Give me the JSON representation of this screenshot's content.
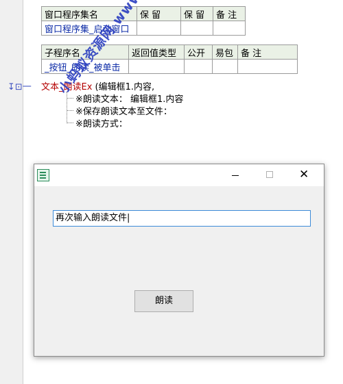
{
  "table1": {
    "headers": [
      "窗口程序集名",
      "保 留",
      "保 留",
      "备 注"
    ],
    "row": [
      "窗口程序集_启动窗口",
      "",
      "",
      ""
    ]
  },
  "table2": {
    "headers": [
      "子程序名",
      "返回值类型",
      "公开",
      "易包",
      "备 注"
    ],
    "row": [
      "_按钮_朗读_被单击",
      "",
      "",
      "",
      ""
    ]
  },
  "code": {
    "marker": "↧⊡一",
    "func_name": "文本_朗读Ex",
    "func_args": " (编辑框1.内容,",
    "params": [
      "※朗读文本： 编辑框1.内容",
      "※保存朗读文本至文件：",
      "※朗读方式："
    ]
  },
  "watermark": "小蚂蚁资源网 www.xmy7.com",
  "dialog": {
    "textbox_value": "再次输入朗读文件|",
    "button_label": "朗读",
    "minimize": "—",
    "maximize": "□",
    "close": "✕"
  }
}
